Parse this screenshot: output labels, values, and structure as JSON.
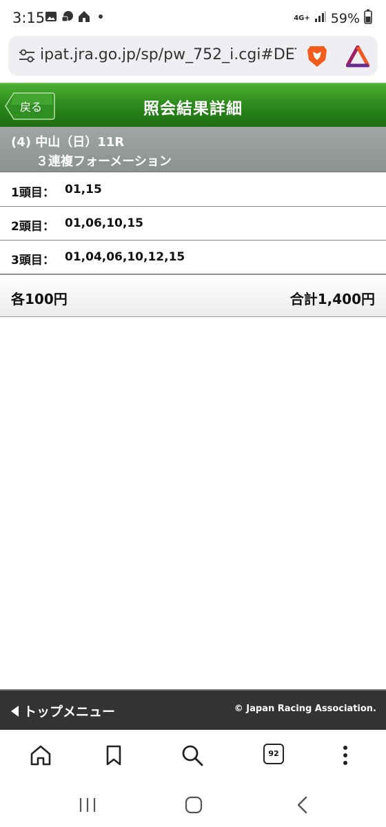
{
  "status_bar": {
    "time": "3:15",
    "network": "4G+",
    "battery": "59%"
  },
  "browser": {
    "url": "ipat.jra.go.jp/sp/pw_752_i.cgi#DET"
  },
  "header": {
    "back_label": "戻る",
    "title": "照会結果詳細"
  },
  "race": {
    "line1": "(4) 中山（日）11R",
    "line2": "３連複フォーメーション"
  },
  "selections": [
    {
      "label": "1頭目：",
      "value": "01,15"
    },
    {
      "label": "2頭目：",
      "value": "01,06,10,15"
    },
    {
      "label": "3頭目：",
      "value": "01,04,06,10,12,15"
    }
  ],
  "totals": {
    "each": "各100円",
    "sum": "合計1,400円"
  },
  "footer": {
    "top_menu": "トップメニュー",
    "copyright": "© Japan Racing Association."
  },
  "browser_toolbar": {
    "tab_count": "92"
  },
  "colors": {
    "header_green": "#2e8b1e",
    "race_gray": "#8a918f",
    "footer_dark": "#333333"
  }
}
